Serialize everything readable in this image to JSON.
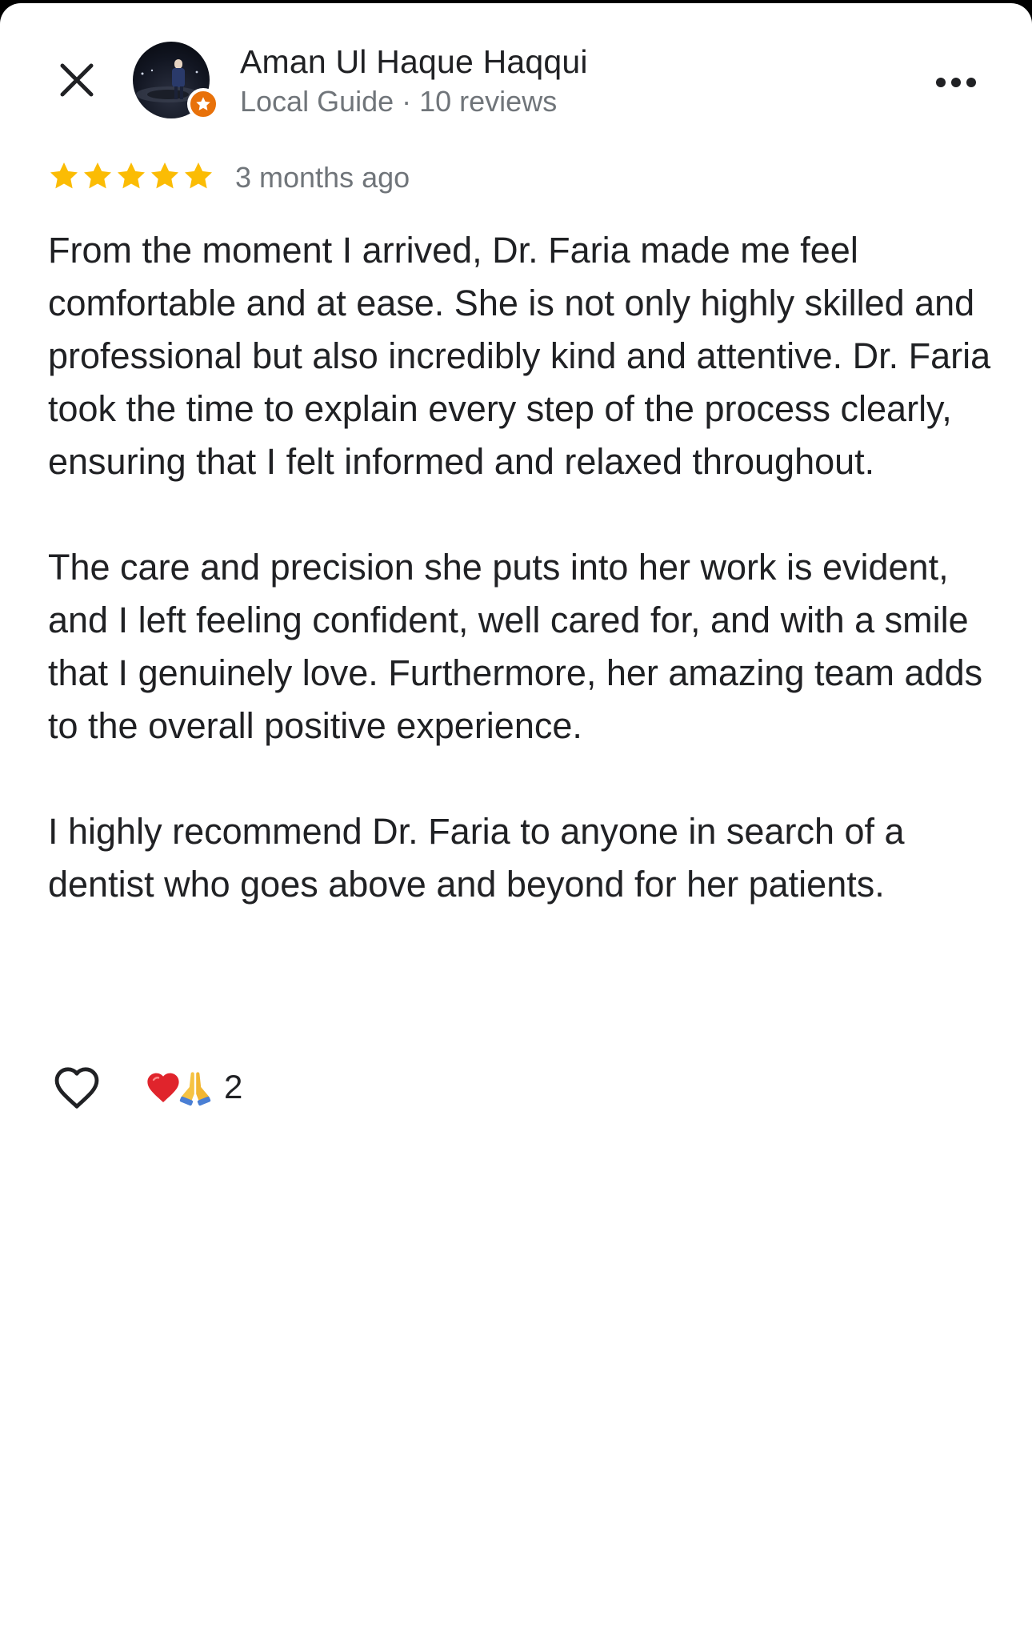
{
  "author": {
    "name": "Aman Ul Haque Haqqui",
    "meta": "Local Guide · 10 reviews"
  },
  "review": {
    "rating": 5,
    "date": "3 months ago",
    "paragraphs": [
      "From the moment I arrived, Dr. Faria made me feel comfortable and at ease. She is not only highly skilled and professional but also incredibly kind and attentive. Dr. Faria took the time to explain every step of the process clearly, ensuring that I felt informed and relaxed throughout.",
      "The care and precision she puts into her work is evident, and I left feeling confident, well cared for, and with a smile that I genuinely love. Furthermore, her amazing team adds to the overall positive experience.",
      "I highly recommend Dr. Faria to anyone in search of a dentist who goes above and beyond for her patients."
    ]
  },
  "reactions": {
    "count": "2",
    "icons": [
      "red-heart-icon",
      "folded-hands-icon"
    ]
  },
  "icons": {
    "close": "close-icon",
    "more": "more-options-icon",
    "star": "star-icon",
    "like": "heart-outline-icon",
    "badge": "local-guide-star-icon"
  },
  "colors": {
    "star": "#fbbc04",
    "badge": "#e8710a",
    "text_primary": "#202124",
    "text_secondary": "#70757a"
  }
}
